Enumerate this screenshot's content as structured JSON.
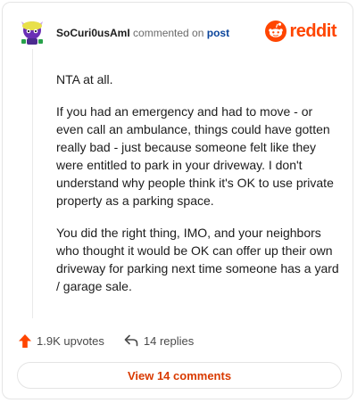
{
  "header": {
    "username": "SoCuri0usAmI",
    "commented_text": "commented on",
    "post_link": "post",
    "brand": "reddit",
    "brand_color": "#ff4500"
  },
  "comment": {
    "paragraphs": [
      "NTA at all.",
      "If you had an emergency and had to move - or even call an ambulance, things could have gotten really bad - just because someone felt like they were entitled to park in your driveway. I don't understand why people think it's OK to use private property as a parking space.",
      "You did the right thing, IMO, and your neighbors who thought it would be OK can offer up their own driveway for parking next time someone has a yard / garage sale."
    ]
  },
  "actions": {
    "upvotes": "1.9K upvotes",
    "replies": "14 replies",
    "upvote_icon": "up-arrow-icon",
    "reply_icon": "reply-arrow-icon"
  },
  "footer": {
    "view_comments": "View 14 comments",
    "accent_color": "#d93a00"
  }
}
